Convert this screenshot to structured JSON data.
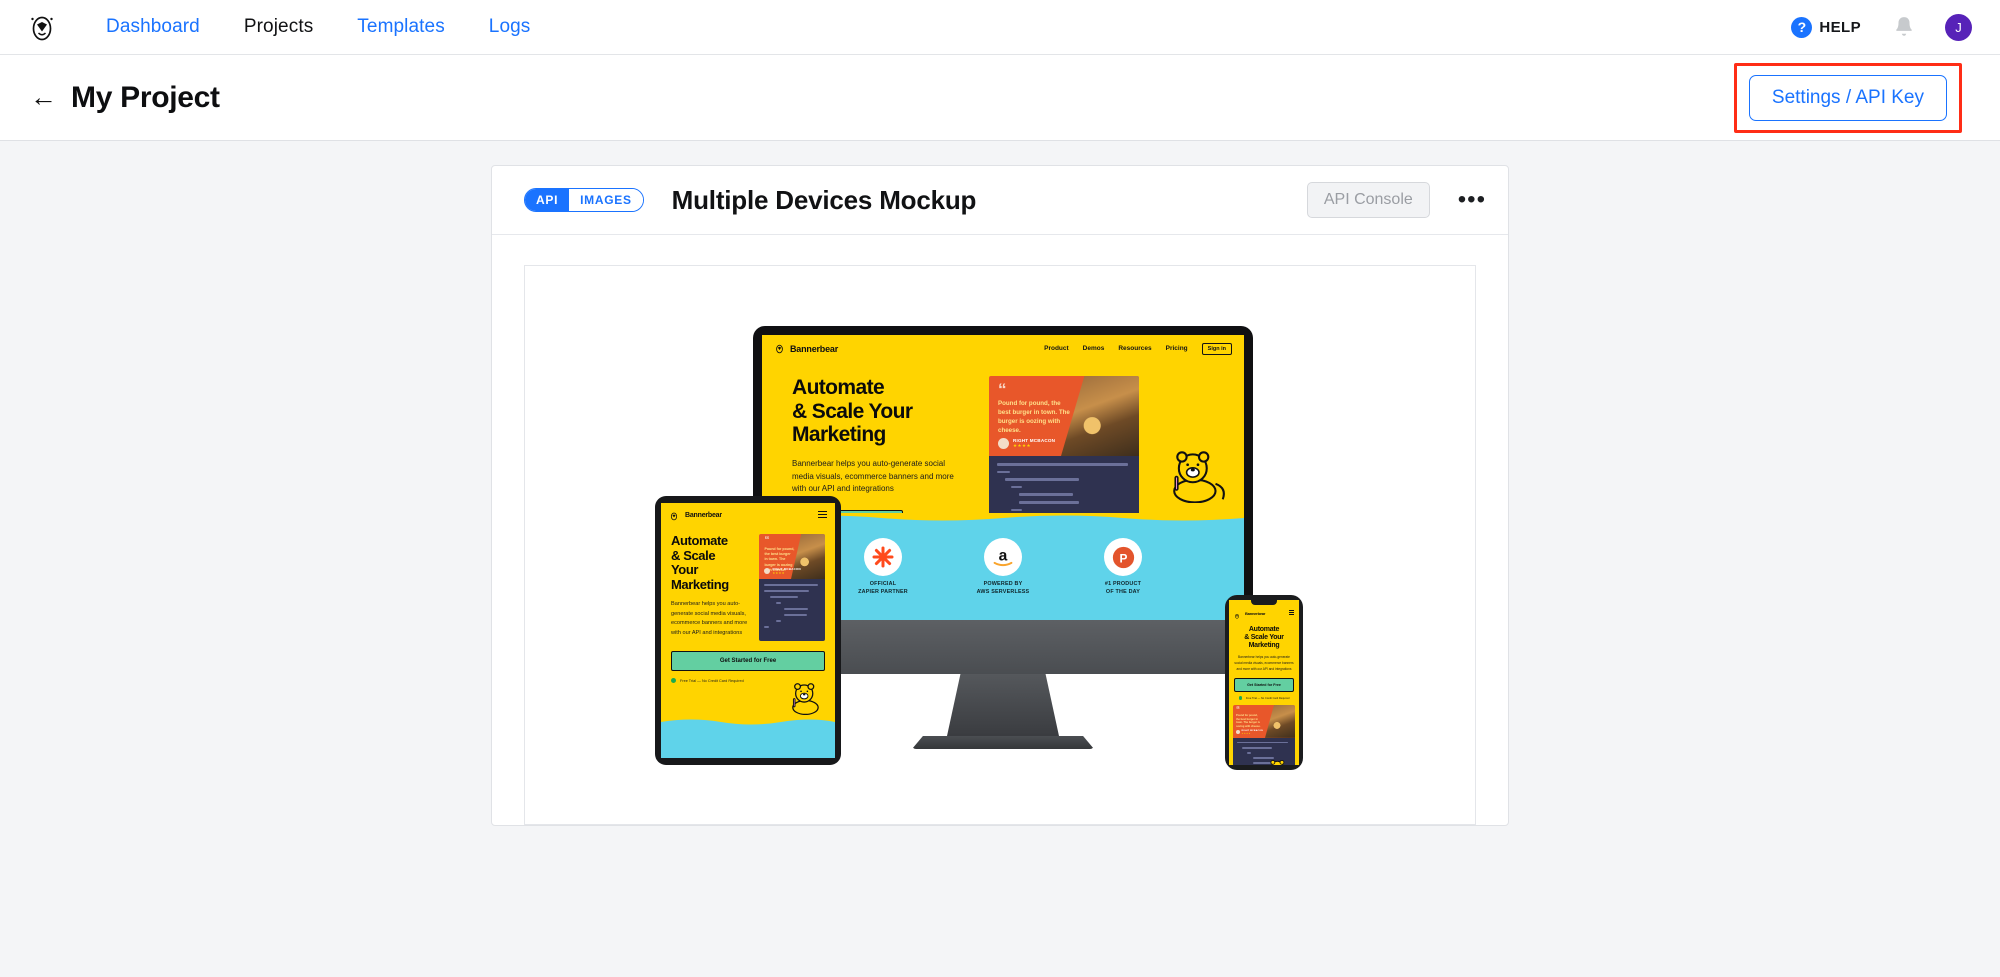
{
  "nav": {
    "logo_icon": "bannerbear-bear-logo",
    "links": [
      {
        "label": "Dashboard",
        "active": false
      },
      {
        "label": "Projects",
        "active": true
      },
      {
        "label": "Templates",
        "active": false
      },
      {
        "label": "Logs",
        "active": false
      }
    ],
    "help": {
      "icon": "question-mark-circle-icon",
      "glyph": "?",
      "label": "HELP"
    },
    "bell_icon": "notification-bell-icon",
    "avatar": {
      "initial": "J",
      "color": "#5722b8"
    }
  },
  "project_bar": {
    "back_arrow": "←",
    "title": "My Project",
    "settings_button": "Settings / API Key",
    "highlight_color": "#ff2d16"
  },
  "card": {
    "badge": {
      "left": "API",
      "right": "IMAGES"
    },
    "title": "Multiple Devices Mockup",
    "api_console_button": "API Console",
    "overflow_menu": "•••"
  },
  "mockup": {
    "brand": "Bannerbear",
    "nav_links": [
      "Product",
      "Demos",
      "Resources",
      "Pricing"
    ],
    "signin": "Sign in",
    "headline_lines": [
      "Automate",
      "& Scale Your",
      "Marketing"
    ],
    "headline_lines_tablet": [
      "Automate",
      "& Scale",
      "Your",
      "Marketing"
    ],
    "paragraph": "Bannerbear helps you auto-generate social media visuals, ecommerce banners and more with our API and integrations",
    "cta": "Get Started for Free",
    "note": "Free Trial — No Credit Card Required",
    "quote": "Pound for pound, the best burger in town. The burger is oozing with cheese.",
    "quote_author": "RIGHT MCBACON",
    "quote_stars": "★★★★",
    "badges": [
      {
        "icon": "zapier-icon",
        "line1": "OFFICIAL",
        "line2": "ZAPIER PARTNER"
      },
      {
        "icon": "amazon-icon",
        "line1": "POWERED BY",
        "line2": "AWS SERVERLESS"
      },
      {
        "icon": "product-hunt-icon",
        "line1": "#1 PRODUCT",
        "line2": "OF THE DAY"
      }
    ],
    "colors": {
      "yellow": "#ffd400",
      "teal": "#5fd3ea",
      "orange": "#e8572a",
      "green": "#63cfa1",
      "code_bg": "#2f3250"
    }
  }
}
